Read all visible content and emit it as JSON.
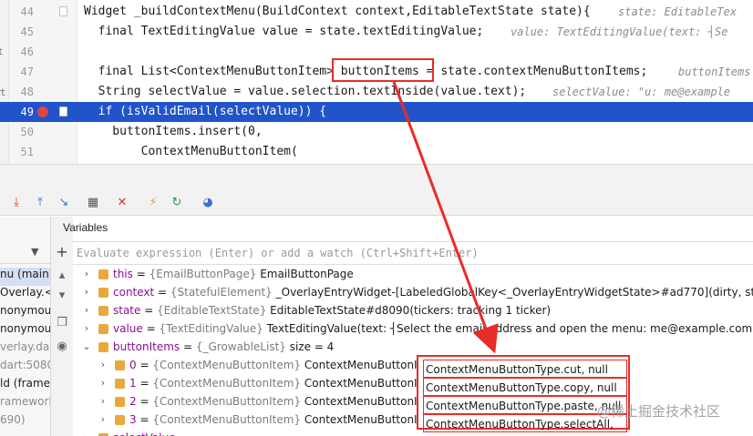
{
  "editor": {
    "left_strip": [
      "rt",
      "art"
    ],
    "lines": [
      {
        "num": "44",
        "code": "Widget _buildContextMenu(BuildContext context,EditableTextState state){",
        "hint": "state: EditableTex"
      },
      {
        "num": "45",
        "code": "  final TextEditingValue value = state.textEditingValue;",
        "hint": "value: TextEditingValue(text: ┤Se"
      },
      {
        "num": "46",
        "code": "",
        "hint": ""
      },
      {
        "num": "47",
        "code": "  final List<ContextMenuButtonItem> buttonItems = state.contextMenuButtonItems;",
        "hint": "buttonItems"
      },
      {
        "num": "48",
        "code": "  String selectValue = value.selection.textInside(value.text);",
        "hint": "selectValue: \"u: me@example"
      },
      {
        "num": "49",
        "code": "  if (isValidEmail(selectValue)) {",
        "hint": ""
      },
      {
        "num": "50",
        "code": "    buttonItems.insert(0,",
        "hint": ""
      },
      {
        "num": "51",
        "code": "        ContextMenuButtonItem(",
        "hint": ""
      }
    ],
    "breakpoint_line": "49"
  },
  "toolbar": {
    "buttons": [
      "step-over-icon",
      "step-into-icon",
      "step-out-icon",
      "run-to-cursor-icon",
      "evaluate-icon",
      "mute-breakpoints-icon",
      "view-breakpoints-icon",
      "hot-reload-icon",
      "hot-restart-icon",
      "devtools-icon"
    ]
  },
  "frames": {
    "items": [
      {
        "text": "nu (main.da",
        "style": "normal"
      },
      {
        "text": "Overlay.<a",
        "style": "normal"
      },
      {
        "text": "nonymous",
        "style": "normal"
      },
      {
        "text": "nonymous",
        "style": "normal"
      },
      {
        "text": "verlay.dar",
        "style": "dim"
      },
      {
        "text": "dart:5080)",
        "style": "dim"
      },
      {
        "text": "ld (framew",
        "style": "normal"
      },
      {
        "text": "ramework",
        "style": "dim"
      },
      {
        "text": "690)",
        "style": "dim"
      }
    ]
  },
  "variables": {
    "title": "Variables",
    "eval_placeholder": "Evaluate expression (Enter) or add a watch (Ctrl+Shift+Enter)",
    "rows": [
      {
        "name": "this",
        "eq": " = ",
        "type": "{EmailButtonPage}",
        "value": " EmailButtonPage",
        "indent": 0,
        "expanded": false
      },
      {
        "name": "context",
        "eq": " = ",
        "type": "{StatefulElement}",
        "value": " _OverlayEntryWidget-[LabeledGlobalKey<_OverlayEntryWidgetState>#ad770](dirty, state: _Ov",
        "indent": 0,
        "expanded": false
      },
      {
        "name": "state",
        "eq": " = ",
        "type": "{EditableTextState}",
        "value": " EditableTextState#d8090(tickers: tracking 1 ticker)",
        "indent": 0,
        "expanded": false
      },
      {
        "name": "value",
        "eq": " = ",
        "type": "{TextEditingValue}",
        "value": " TextEditingValue(text: ┤Select the email address and open the menu: me@example.com├, sele",
        "indent": 0,
        "expanded": false
      },
      {
        "name": "buttonItems",
        "eq": " = ",
        "type": "{_GrowableList}",
        "value": " size = 4",
        "indent": 0,
        "expanded": true
      },
      {
        "name": "0",
        "eq": " = ",
        "type": "{ContextMenuButtonItem}",
        "value": " ContextMenuButtonItem",
        "indent": 1,
        "expanded": false
      },
      {
        "name": "1",
        "eq": " = ",
        "type": "{ContextMenuButtonItem}",
        "value": " ContextMenuButtonItem",
        "indent": 1,
        "expanded": false
      },
      {
        "name": "2",
        "eq": " = ",
        "type": "{ContextMenuButtonItem}",
        "value": " ContextMenuButtonItem",
        "indent": 1,
        "expanded": false
      },
      {
        "name": "3",
        "eq": " = ",
        "type": "{ContextMenuButtonItem}",
        "value": " ContextMenuButtonItem",
        "indent": 1,
        "expanded": false
      },
      {
        "name": "selectValue",
        "eq": " = ",
        "type": "",
        "value": "",
        "indent": 0,
        "expanded": false
      }
    ],
    "callouts": [
      "ContextMenuButtonType.cut, null",
      "ContextMenuButtonType.copy, null",
      "ContextMenuButtonType.paste, null",
      "ContextMenuButtonType.selectAll, null"
    ]
  },
  "annotation": {
    "highlighted_code": "buttonItems",
    "color": "#e82c28"
  },
  "watermark": "@稀土掘金技术社区",
  "colors": {
    "current_line": "#2154c9",
    "breakpoint": "#e0434b",
    "keyword": "#0033b3",
    "field": "#871094"
  }
}
